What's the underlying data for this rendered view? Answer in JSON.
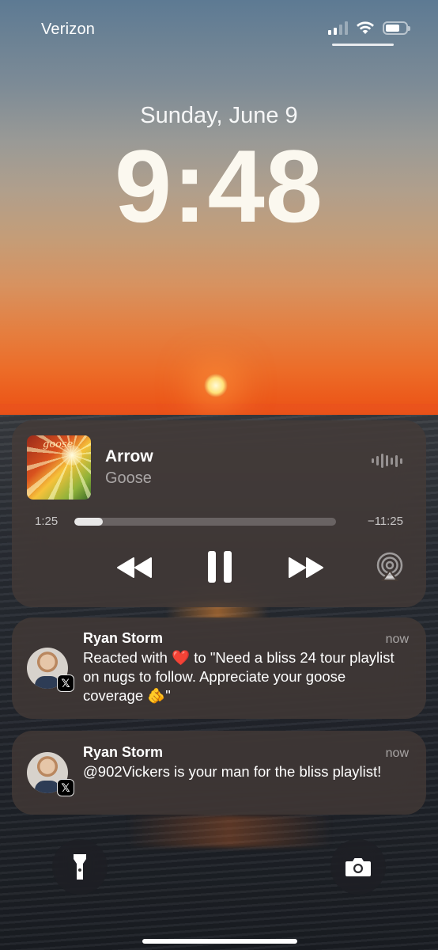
{
  "status_bar": {
    "carrier": "Verizon",
    "signal_icon": "cellular-signal-icon",
    "wifi_icon": "wifi-icon",
    "battery_icon": "battery-icon"
  },
  "lock_screen": {
    "date": "Sunday, June 9",
    "time": "9:48"
  },
  "now_playing": {
    "title": "Arrow",
    "artist": "Goose",
    "album_art_text": "goose",
    "elapsed": "1:25",
    "remaining": "−11:25",
    "progress_fraction": 0.11,
    "controls": [
      "rewind-icon",
      "pause-icon",
      "fast-forward-icon",
      "airplay-icon"
    ]
  },
  "notifications": [
    {
      "sender": "Ryan Storm",
      "time": "now",
      "app_badge": "𝕏",
      "body": "Reacted with ❤️ to \"Need a bliss 24 tour playlist on nugs to follow. Appreciate your goose coverage 🫵\""
    },
    {
      "sender": "Ryan Storm",
      "time": "now",
      "app_badge": "𝕏",
      "body": "@902Vickers is your man for the bliss playlist!"
    }
  ],
  "quick_actions": {
    "left": "flashlight-icon",
    "right": "camera-icon"
  },
  "colors": {
    "time_text": "#fbf8ef",
    "card_bg": "rgba(70,60,55,0.72)"
  }
}
